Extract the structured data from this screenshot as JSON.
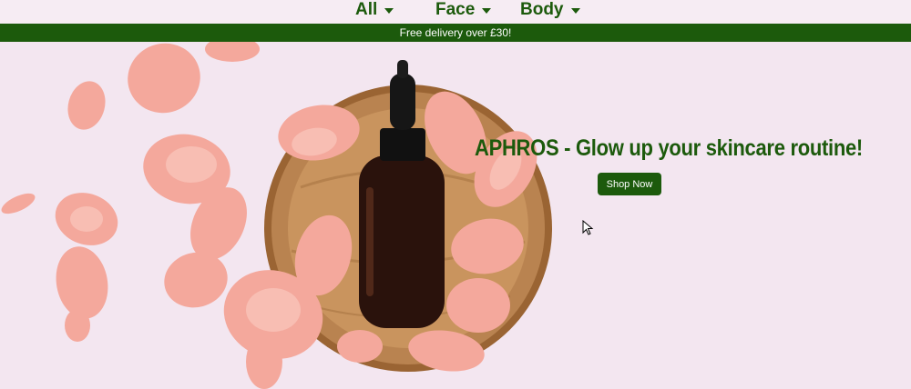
{
  "nav": {
    "items": [
      {
        "label": "All"
      },
      {
        "label": "Face"
      },
      {
        "label": "Body"
      }
    ]
  },
  "banner": {
    "text": "Free delivery over £30!"
  },
  "hero": {
    "title": "APHROS - Glow up your skincare routine!",
    "cta_label": "Shop Now"
  },
  "colors": {
    "brand_green": "#1c5a0c",
    "background_pink": "#f3e6f0",
    "petal_pink": "#f4a89c",
    "bowl_wood": "#b07a45",
    "bottle_amber": "#2a120c"
  },
  "icons": {
    "dropdown": "chevron-down-icon",
    "pointer": "mouse-pointer-icon"
  }
}
